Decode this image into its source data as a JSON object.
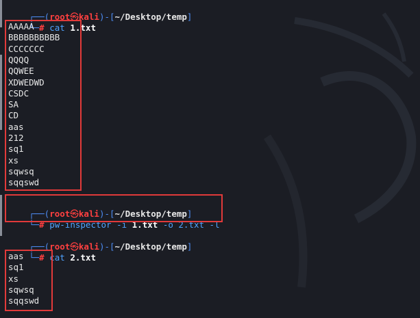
{
  "prompt": {
    "open": "┌──(",
    "user": "root",
    "at": "㉿",
    "host": "kali",
    "mid": ")-[",
    "path": "~/Desktop/temp",
    "close": "]",
    "cont": "└─",
    "hash": "#"
  },
  "blocks": [
    {
      "command": "cat",
      "args": [
        {
          "text": " 1.txt",
          "style": "file"
        }
      ],
      "output": [
        "AAAAA",
        "BBBBBBBBBB",
        "CCCCCCC",
        "QQQQ",
        "QQWEE",
        "XDWEDWD",
        "CSDC",
        "SA",
        "CD",
        "aas",
        "212",
        "sq1",
        "xs",
        "sqwsq",
        "sqqswd"
      ]
    },
    {
      "command": "pw-inspector",
      "args": [
        {
          "text": " -i ",
          "style": "opt"
        },
        {
          "text": "1.txt",
          "style": "file"
        },
        {
          "text": " -o 2.txt -l",
          "style": "opt"
        }
      ],
      "output": []
    },
    {
      "command": "cat",
      "args": [
        {
          "text": " 2.txt",
          "style": "file"
        }
      ],
      "output": [
        "aas",
        "sq1",
        "xs",
        "sqwsq",
        "sqqswd"
      ]
    }
  ],
  "colors": {
    "background": "#1b1d24",
    "prompt_frame": "#4d8df5",
    "prompt_user": "#ff4040",
    "command": "#4fa3ff",
    "highlight_box": "#e23a3a"
  }
}
